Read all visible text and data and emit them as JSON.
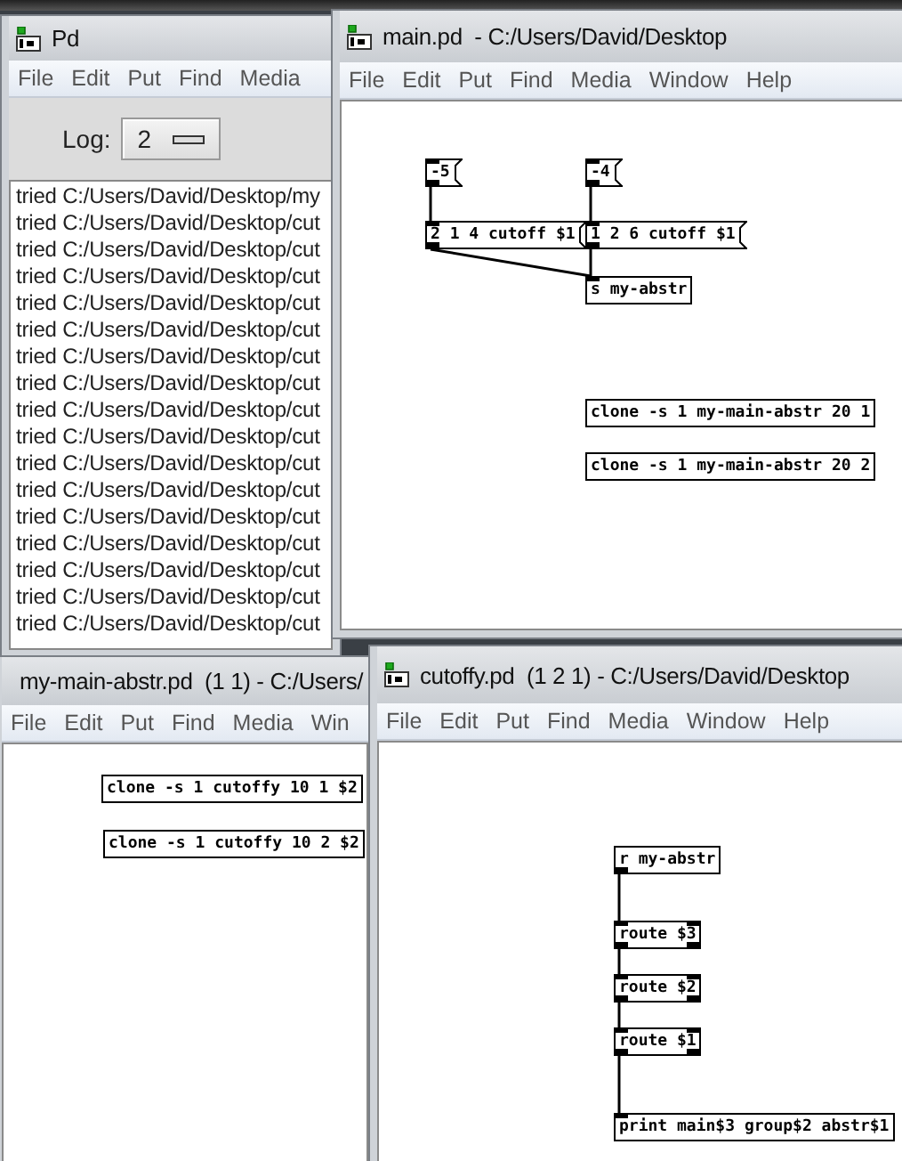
{
  "windows": [
    {
      "kind": "console",
      "title": "Pd",
      "menu": [
        "File",
        "Edit",
        "Put",
        "Find",
        "Media"
      ],
      "log": {
        "label": "Log:",
        "value": "2"
      },
      "lines": [
        "tried C:/Users/David/Desktop/my",
        "tried C:/Users/David/Desktop/cut",
        "tried C:/Users/David/Desktop/cut",
        "tried C:/Users/David/Desktop/cut",
        "tried C:/Users/David/Desktop/cut",
        "tried C:/Users/David/Desktop/cut",
        "tried C:/Users/David/Desktop/cut",
        "tried C:/Users/David/Desktop/cut",
        "tried C:/Users/David/Desktop/cut",
        "tried C:/Users/David/Desktop/cut",
        "tried C:/Users/David/Desktop/cut",
        "tried C:/Users/David/Desktop/cut",
        "tried C:/Users/David/Desktop/cut",
        "tried C:/Users/David/Desktop/cut",
        "tried C:/Users/David/Desktop/cut",
        "tried C:/Users/David/Desktop/cut",
        "tried C:/Users/David/Desktop/cut"
      ]
    },
    {
      "kind": "patch",
      "title": "main.pd  - C:/Users/David/Desktop",
      "menu": [
        "File",
        "Edit",
        "Put",
        "Find",
        "Media",
        "Window",
        "Help"
      ],
      "boxes": [
        {
          "kind": "message",
          "text": "-5"
        },
        {
          "kind": "message",
          "text": "-4"
        },
        {
          "kind": "message",
          "text": "2 1 4 cutoff $1"
        },
        {
          "kind": "message",
          "text": "1 2 6 cutoff $1"
        },
        {
          "kind": "object",
          "text": "s my-abstr"
        },
        {
          "kind": "object",
          "text": "clone -s 1 my-main-abstr 20 1"
        },
        {
          "kind": "object",
          "text": "clone -s 1 my-main-abstr 20 2"
        }
      ]
    },
    {
      "kind": "patch",
      "title": "my-main-abstr.pd  (1 1) - C:/Users/",
      "menu": [
        "File",
        "Edit",
        "Put",
        "Find",
        "Media",
        "Win"
      ],
      "boxes": [
        {
          "kind": "object",
          "text": "clone -s 1 cutoffy 10 1 $2"
        },
        {
          "kind": "object",
          "text": "clone -s 1 cutoffy 10 2 $2"
        }
      ]
    },
    {
      "kind": "patch",
      "title": "cutoffy.pd  (1 2 1) - C:/Users/David/Desktop",
      "menu": [
        "File",
        "Edit",
        "Put",
        "Find",
        "Media",
        "Window",
        "Help"
      ],
      "boxes": [
        {
          "kind": "object",
          "text": "r my-abstr"
        },
        {
          "kind": "object",
          "text": "route $3"
        },
        {
          "kind": "object",
          "text": "route $2"
        },
        {
          "kind": "object",
          "text": "route $1"
        },
        {
          "kind": "object",
          "text": "print main$3 group$2 abstr$1"
        }
      ]
    }
  ]
}
